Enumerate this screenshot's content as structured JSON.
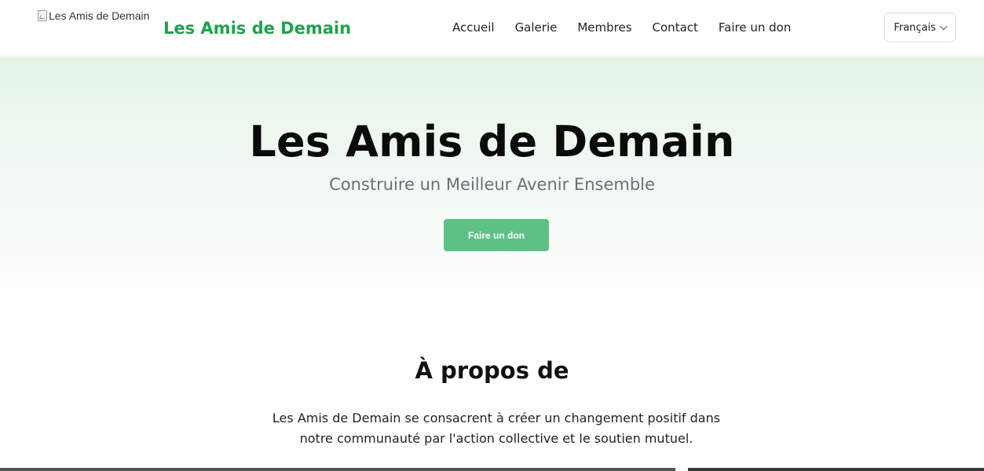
{
  "header": {
    "logo_alt": "Les Amis de Demain",
    "brand_name": "Les Amis de Demain",
    "brand_color": "#22a04b",
    "nav": [
      {
        "label": "Accueil"
      },
      {
        "label": "Galerie"
      },
      {
        "label": "Membres"
      },
      {
        "label": "Contact"
      },
      {
        "label": "Faire un don"
      }
    ],
    "language": {
      "selected": "Français",
      "icon": "chevron-down-icon"
    }
  },
  "hero": {
    "title": "Les Amis de Demain",
    "subtitle": "Construire un Meilleur Avenir Ensemble",
    "cta_label": "Faire un don",
    "cta_color": "#5ec184",
    "background_tint": "#e6f4e8"
  },
  "about": {
    "title": "À propos de",
    "text": "Les Amis de Demain se consacrent à créer un changement positif dans notre communauté par l'action collective et le soutien mutuel."
  }
}
